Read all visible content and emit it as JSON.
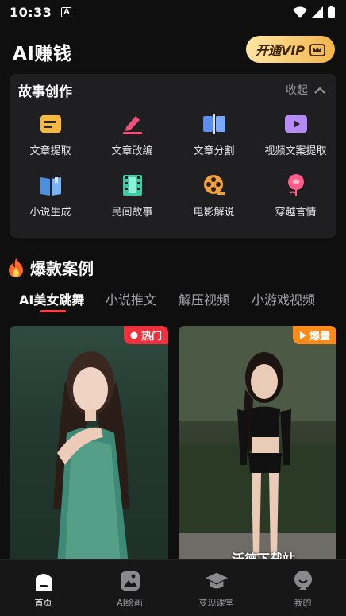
{
  "status_bar": {
    "time": "10:33",
    "notif_glyph": "A"
  },
  "header": {
    "title": "AI赚钱",
    "vip_label": "开通VIP"
  },
  "story_card": {
    "title": "故事创作",
    "collapse_label": "收起",
    "tools": [
      {
        "label": "文章提取",
        "icon": "doc-extract-icon"
      },
      {
        "label": "文章改编",
        "icon": "edit-pencil-icon"
      },
      {
        "label": "文章分割",
        "icon": "split-icon"
      },
      {
        "label": "视频文案提取",
        "icon": "video-play-icon"
      },
      {
        "label": "小说生成",
        "icon": "book-icon"
      },
      {
        "label": "民间故事",
        "icon": "film-strip-icon"
      },
      {
        "label": "电影解说",
        "icon": "film-reel-icon"
      },
      {
        "label": "穿越言情",
        "icon": "rose-icon"
      }
    ]
  },
  "hot_section": {
    "title": "爆款案例",
    "tabs": [
      "AI美女跳舞",
      "小说推文",
      "解压视频",
      "小游戏视频"
    ],
    "cards": [
      {
        "badge": "热门"
      },
      {
        "badge": "爆量"
      }
    ],
    "watermark": "沃德下载站"
  },
  "bottom_nav": {
    "items": [
      {
        "label": "首页",
        "icon": "home-icon"
      },
      {
        "label": "AI绘画",
        "icon": "image-icon"
      },
      {
        "label": "变现课堂",
        "icon": "graduation-cap-icon"
      },
      {
        "label": "我的",
        "icon": "profile-icon"
      }
    ]
  },
  "colors": {
    "accent": "#ff3b4a",
    "vip_gold": "#f3b44a",
    "badge_hot": "#f0303c",
    "badge_boom": "#ff8a18"
  }
}
